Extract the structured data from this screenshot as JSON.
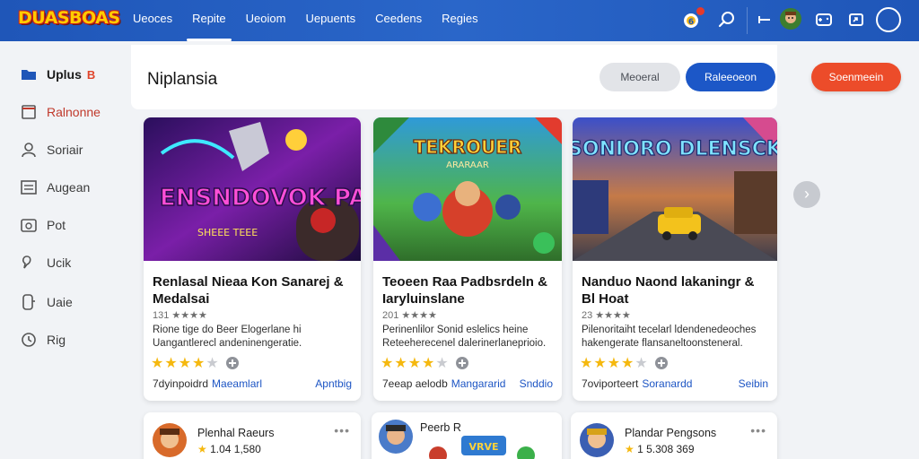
{
  "app": {
    "logo_text": "DUASBOAS",
    "nav": [
      "Ueoces",
      "Repite",
      "Ueoiom",
      "Uepuents",
      "Ceedens",
      "Regies"
    ],
    "active_nav_index": 1,
    "notification_count_dot": true
  },
  "sidebar": {
    "items": [
      {
        "label": "Uplus",
        "badge": "B",
        "icon": "folder-icon"
      },
      {
        "label": "Ralnonne",
        "icon": "document-icon"
      },
      {
        "label": "Soriair",
        "icon": "user-icon"
      },
      {
        "label": "Augean",
        "icon": "list-icon"
      },
      {
        "label": "Pot",
        "icon": "image-icon"
      },
      {
        "label": "Ucik",
        "icon": "pin-icon"
      },
      {
        "label": "Uaie",
        "icon": "phone-icon"
      },
      {
        "label": "Rig",
        "icon": "clock-icon"
      }
    ]
  },
  "page": {
    "title": "Niplansia",
    "btn_secondary": "Meoeral",
    "btn_primary": "Raleeoeon",
    "btn_action": "Soenmeein"
  },
  "cards": [
    {
      "art_title": "ENSNDOVOK PALEEN",
      "art_sub": "SHEEE TEEE",
      "title": "Renlasal Nieaa Kon Sanarej & Medalsai",
      "rating_line": "131 ★★★★",
      "desc": "Rione tige do Beer Elogerlane hi Uangantlerecl andeninengeratie.",
      "stars": 4,
      "foot_label": "7dyinpoidrd",
      "foot_link": "Maeamlarl",
      "foot_right": "Apntbig"
    },
    {
      "art_title": "TEKROUER",
      "art_sub": "ARARAAR",
      "title": "Teoeen Raa Padbsrdeln & Iaryluinslane",
      "rating_line": "201 ★★★★",
      "desc": "Perinenlilor Sonid eslelics heine Reteeherecenel dalerinerlaneprioio.",
      "stars": 4,
      "foot_label": "7eeap aelodb",
      "foot_link": "Mangararid",
      "foot_right": "Snddio"
    },
    {
      "art_title": "SONIORO DLENSCK",
      "art_sub": "",
      "title": "Nanduo Naond lakaningr & Bl Hoat",
      "rating_line": "23 ★★★★",
      "desc": "Pilenoritaiht tecelarl ldendenedeoches hakengerate flansaneltoonsteneral.",
      "stars": 4,
      "foot_label": "7oviporteert",
      "foot_link": "Soranardd",
      "foot_right": "Seibin"
    }
  ],
  "bottom_cards": [
    {
      "title": "Plenhal Raeurs",
      "meta": "1.04 1,580"
    },
    {
      "title": "Peerb R",
      "meta": ""
    },
    {
      "title": "Plandar Pengsons",
      "meta": "1 5.308 369"
    }
  ]
}
